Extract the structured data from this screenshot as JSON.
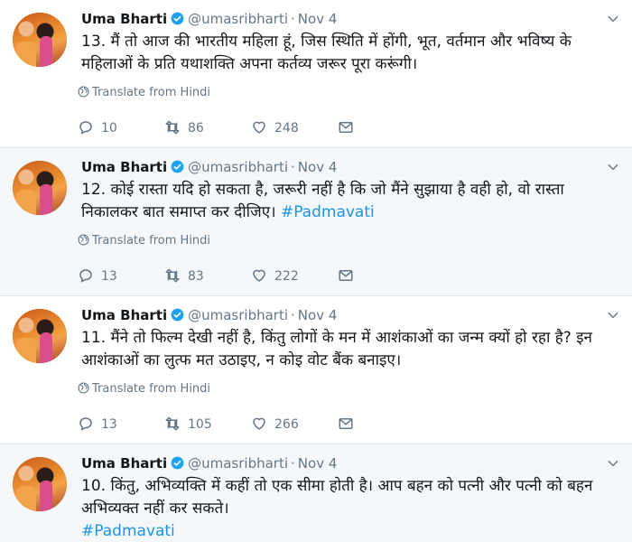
{
  "tweets": [
    {
      "name": "Uma Bharti",
      "handle": "@umasribharti",
      "separator": "·",
      "date": "Nov 4",
      "text": "13. मैं तो आज की भारतीय महिला हूं, जिस स्थिति में होंगी, भूत, वर्तमान और भविष्य के महिलाओं के प्रति यथाशक्ति अपना कर्तव्य जरूर पूरा करूंगी।",
      "hashtag": "",
      "translate": "Translate from Hindi",
      "replies": "10",
      "retweets": "86",
      "likes": "248"
    },
    {
      "name": "Uma Bharti",
      "handle": "@umasribharti",
      "separator": "·",
      "date": "Nov 4",
      "text": "12. कोई रास्ता यदि हो सकता है, जरूरी नहीं है कि जो मैंने सुझाया है वही हो, वो रास्ता निकालकर बात समाप्त कर दीजिए।",
      "hashtag": "#Padmavati",
      "translate": "Translate from Hindi",
      "replies": "13",
      "retweets": "83",
      "likes": "222"
    },
    {
      "name": "Uma Bharti",
      "handle": "@umasribharti",
      "separator": "·",
      "date": "Nov 4",
      "text": "11. मैंने तो फिल्म देखी नहीं है, किंतु लोगों के मन में आशंकाओं का जन्म क्यों हो रहा है? इन आशंकाओं का लुत्फ मत उठाइए, न कोइ वोट बैंक बनाइए।",
      "hashtag": "",
      "translate": "Translate from Hindi",
      "replies": "13",
      "retweets": "105",
      "likes": "266"
    },
    {
      "name": "Uma Bharti",
      "handle": "@umasribharti",
      "separator": "·",
      "date": "Nov 4",
      "text": "10. किंतु, अभिव्यक्ति में कहीं तो एक सीमा होती है। आप बहन को पत्नी और पत्नी को बहन अभिव्यक्त नहीं कर सकते।",
      "hashtag": "#Padmavati"
    }
  ],
  "colors": {
    "link": "#1b95e0",
    "muted": "#657786",
    "verified": "#1da1f2",
    "alt_background": "#f5f8fa",
    "border": "#e1e8ed"
  },
  "icons": [
    "verified-badge-icon",
    "caret-down-icon",
    "globe-icon",
    "reply-icon",
    "retweet-icon",
    "like-icon",
    "direct-message-icon"
  ]
}
